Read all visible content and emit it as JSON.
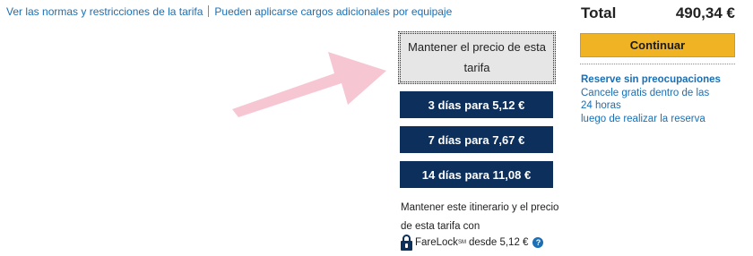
{
  "links": {
    "rules": "Ver las normas y restricciones de la tarifa",
    "baggage": "Pueden aplicarse cargos adicionales por equipaje"
  },
  "hold": {
    "main_label": "Mantener el precio de esta tarifa",
    "options": [
      {
        "label": "3 días para 5,12 €"
      },
      {
        "label": "7 días para 7,67 €"
      },
      {
        "label": "14 días para 11,08 €"
      }
    ],
    "description": "Mantener este itinerario y el precio de esta tarifa con",
    "farelock_name": "FareLock",
    "farelock_mark": "SM",
    "farelock_price": "desde 5,12 €",
    "help_glyph": "?"
  },
  "summary": {
    "total_label": "Total",
    "total_value": "490,34 €",
    "continue_label": "Continuar"
  },
  "reserve": {
    "title": "Reserve sin preocupaciones",
    "line1": "Cancele gratis dentro de las",
    "line2": "24 horas",
    "line3": "luego de realizar la reserva"
  },
  "colors": {
    "navy": "#0c2f5c",
    "link_blue": "#1a6fb5",
    "button_yellow": "#f0b323",
    "arrow_pink": "#f7c6d3"
  },
  "icons": {
    "lock": "lock-icon",
    "help": "help-icon",
    "arrow": "arrow-annotation-icon"
  }
}
